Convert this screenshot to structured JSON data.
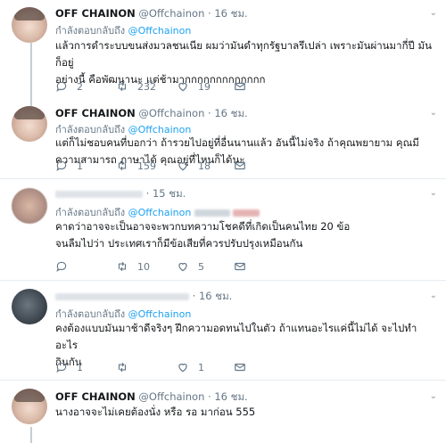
{
  "reply_prefix": "กำลังตอบกลับถึง",
  "tweets": [
    {
      "name": "OFF CHAINON",
      "handle": "@Offchainon",
      "time": "16 ชม.",
      "reply_to": "@Offchainon",
      "text_lines": [
        "แล้วการดำระบบขนส่งมวลชนเนีย ผมว่ามันดำทุกรัฐบาลรึเปล่า เพราะมันผ่านมากี่ปี มันก็อยู่",
        "อย่างนี้ คือพัฒนานะ แต่ช้ามากกกกกกกกกกกกก"
      ],
      "replies": "2",
      "retweets": "232",
      "likes": "19"
    },
    {
      "name": "OFF CHAINON",
      "handle": "@Offchainon",
      "time": "16 ชม.",
      "reply_to": "@Offchainon",
      "text_lines": [
        "แต่ก็ไม่ชอบคนที่บอกว่า ถ้ารวยไปอยู่ที่อื่นนานแล้ว อันนี้ไม่จริง ถ้าคุณพยายาม คุณมี",
        "ความสามารถ ภาษาได้ คุณอยู่ที่ไหนก็ได้นะ"
      ],
      "replies": "1",
      "retweets": "159",
      "likes": "18"
    },
    {
      "time": "15 ชม.",
      "reply_to": "@Offchainon",
      "text_lines": [
        "คาดว่าอาจจะเป็นอาจจะพวกบทความโชคดีที่เกิดเป็นคนไทย 20 ข้อ",
        "จนลืมไปว่า ประเทศเราก็มีข้อเสียที่ควรปรับปรุงเหมือนกัน"
      ],
      "replies": "",
      "retweets": "10",
      "likes": "5"
    },
    {
      "time": "16 ชม.",
      "reply_to": "@Offchainon",
      "text_lines": [
        "คงต้องแบบมันมาช้าดีจริงๆ ฝึกความอดทนไปในตัว ถ้าแทนอะไรแค่นี้ไม่ได้ จะไปทำอะไร",
        "กินกัน"
      ],
      "replies": "1",
      "retweets": "",
      "likes": "1"
    },
    {
      "name": "OFF CHAINON",
      "handle": "@Offchainon",
      "time": "16 ชม.",
      "text_lines": [
        "นางอาจจะไม่เคยต้องนั่ง หรือ รอ มาก่อน 555"
      ]
    }
  ],
  "icons": {
    "reply": "reply-icon",
    "retweet": "retweet-icon",
    "like": "heart-icon",
    "message": "envelope-icon",
    "caret": "chevron-down-icon"
  },
  "colors": {
    "link": "#1da1f2",
    "secondary_text": "#657786",
    "divider": "#e6ecf0",
    "thread_line": "#c4cfd6"
  }
}
